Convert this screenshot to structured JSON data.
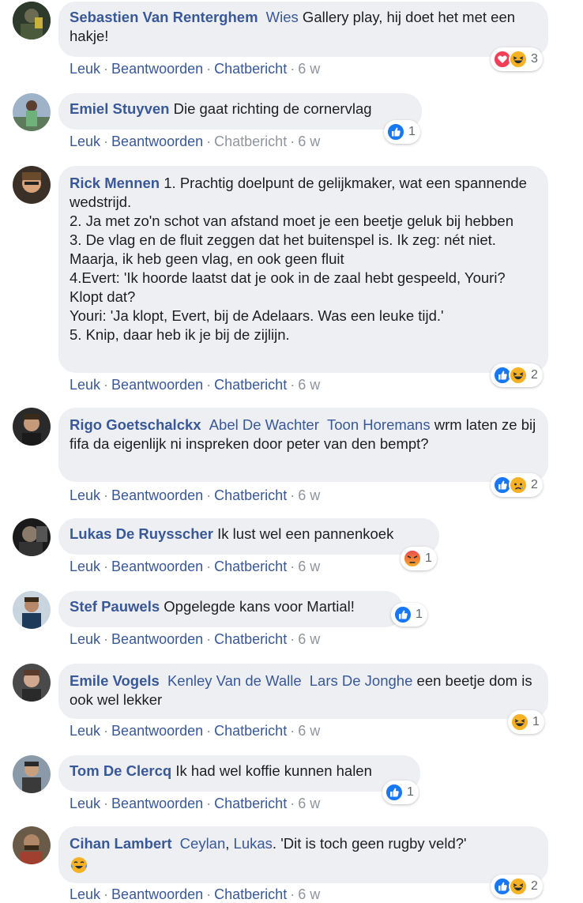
{
  "comments": [
    {
      "author": "Sebastien Van Renterghem",
      "mentions": [
        "Wies"
      ],
      "text": " Gallery play, hij doet het met een hakje!",
      "reactions": [
        "love",
        "haha"
      ],
      "reaction_count": "3"
    },
    {
      "author": "Emiel Stuyven",
      "text": " Die gaat richting de cornervlag",
      "reactions": [
        "like"
      ],
      "reaction_count": "1"
    },
    {
      "author": "Rick Mennen",
      "text": " 1. Prachtig doelpunt de gelijkmaker, wat een spannende wedstrijd.",
      "lines": [
        "2. Ja met zo'n schot van afstand moet je een beetje geluk bij hebben",
        "3. De vlag en de fluit zeggen dat het buitenspel is. Ik zeg: nét niet. Maarja, ik heb geen vlag, en ook geen fluit",
        "4.Evert: 'Ik hoorde laatst dat je ook in de zaal hebt gespeeld, Youri? Klopt dat?",
        "Youri: 'Ja klopt, Evert, bij de Adelaars. Was een leuke tijd.'",
        "5. Knip, daar heb ik je bij de zijlijn."
      ],
      "reactions": [
        "like",
        "haha"
      ],
      "reaction_count": "2"
    },
    {
      "author": "Rigo Goetschalckx",
      "mentions": [
        "Abel De Wachter",
        "Toon Horemans"
      ],
      "text": " wrm laten ze bij fifa da eigenlijk ni inspreken door peter van den bempt?",
      "reactions": [
        "like",
        "sad"
      ],
      "reaction_count": "2"
    },
    {
      "author": "Lukas De Ruysscher",
      "text": " Ik lust wel een pannenkoek",
      "reactions": [
        "angry"
      ],
      "reaction_count": "1"
    },
    {
      "author": "Stef Pauwels",
      "text": " Opgelegde kans voor Martial!",
      "reactions": [
        "like"
      ],
      "reaction_count": "1"
    },
    {
      "author": "Emile Vogels",
      "mentions": [
        "Kenley Van de Walle",
        "Lars De Jonghe"
      ],
      "text": " een beetje dom is ook wel lekker",
      "reactions": [
        "haha"
      ],
      "reaction_count": "1"
    },
    {
      "author": "Tom De Clercq",
      "text": " Ik had wel koffie kunnen halen",
      "reactions": [
        "like"
      ],
      "reaction_count": "1"
    },
    {
      "author": "Cihan Lambert",
      "mentions": [
        "Ceylan",
        "Lukas"
      ],
      "text": ". 'Dit is toch geen rugby veld?'",
      "reactions": [
        "like",
        "haha"
      ],
      "reaction_count": "2"
    }
  ],
  "actions": {
    "like": "Leuk",
    "reply": "Beantwoorden",
    "chat": "Chatbericht",
    "time": "6 w",
    "sep": "·"
  },
  "colors": {
    "name": "#385898",
    "meta": "#90949c",
    "bubble": "#eeeff2",
    "like": "#1877f2",
    "love": "#f33e58",
    "haha": "#f7b125",
    "angry": "#e9710f"
  }
}
